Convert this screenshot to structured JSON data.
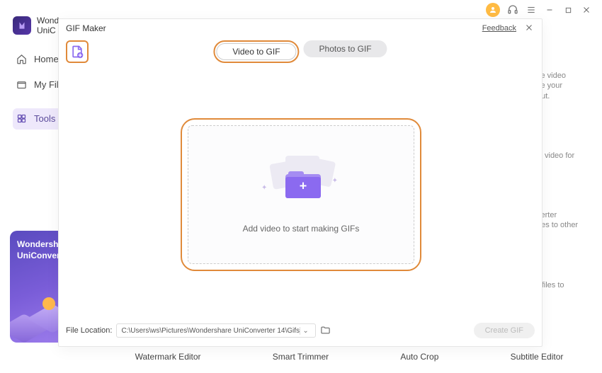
{
  "titlebar": {
    "avatar_color": "#ffbb44"
  },
  "sidebar": {
    "brand_line1": "Wonde",
    "brand_line2": "UniC",
    "items": [
      {
        "label": "Home"
      },
      {
        "label": "My Fil"
      },
      {
        "label": "Tools"
      }
    ]
  },
  "promo": {
    "title_line1": "Wondersha",
    "title_line2": "UniConverter"
  },
  "bottom_tools": [
    "Watermark Editor",
    "Smart Trimmer",
    "Auto Crop",
    "Subtitle Editor"
  ],
  "bg_hints": [
    "se video\nke your\nout.",
    "D video for",
    "verter\nges to other",
    "r files to"
  ],
  "modal": {
    "title": "GIF Maker",
    "feedback": "Feedback",
    "tabs": {
      "video": "Video to GIF",
      "photos": "Photos to GIF"
    },
    "drop_text": "Add video to start making GIFs",
    "footer": {
      "label": "File Location:",
      "path": "C:\\Users\\ws\\Pictures\\Wondershare UniConverter 14\\Gifs",
      "create": "Create GIF"
    }
  }
}
